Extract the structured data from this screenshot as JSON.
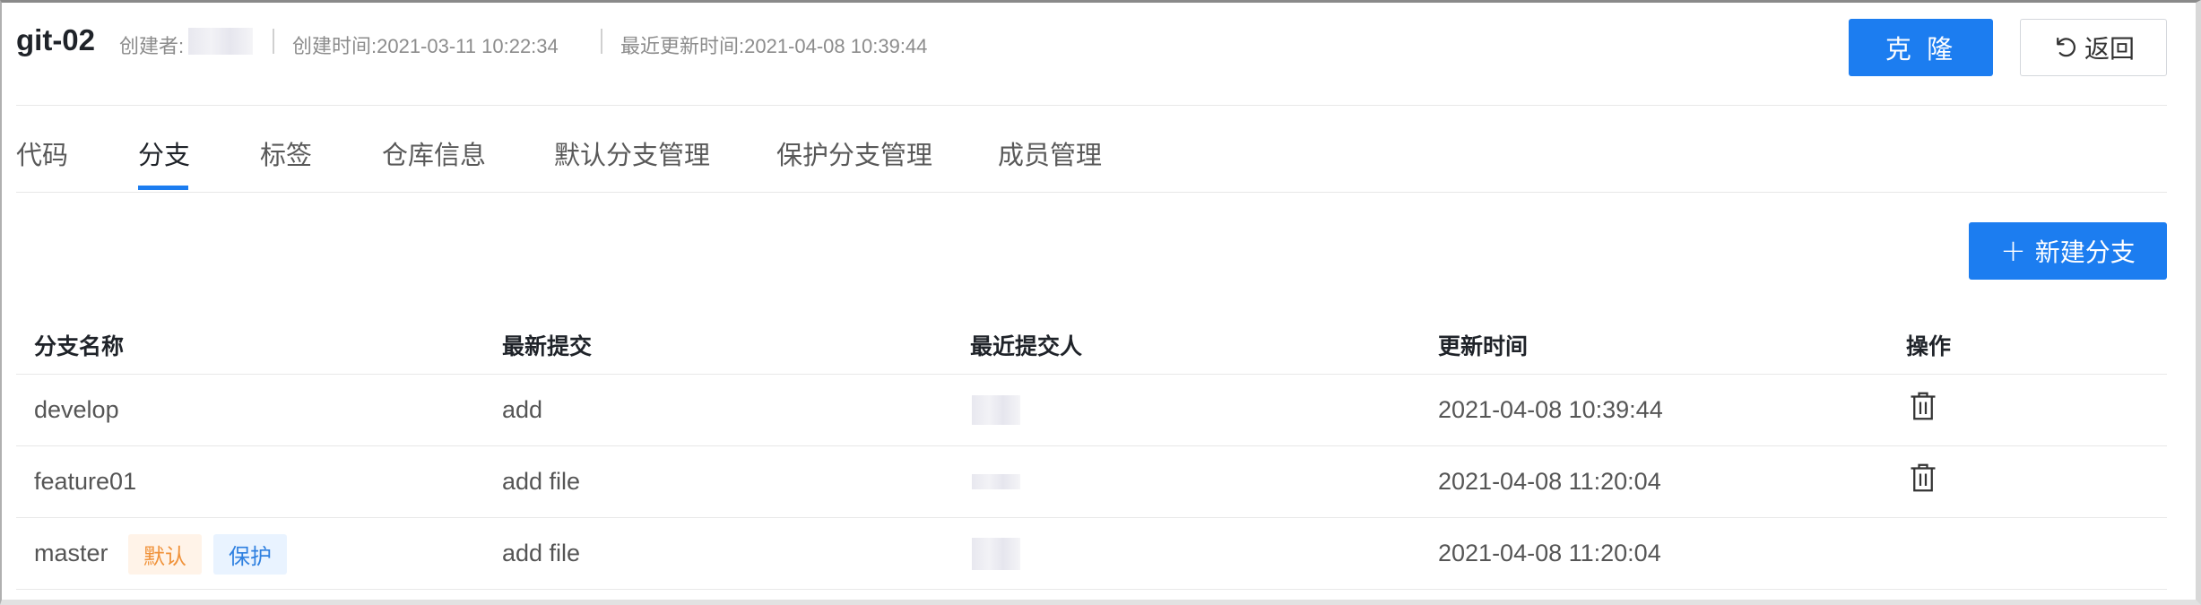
{
  "header": {
    "repo_name": "git-02",
    "creator_label": "创建者:",
    "created_time": "创建时间:2021-03-11 10:22:34",
    "updated_time": "最近更新时间:2021-04-08 10:39:44",
    "clone_button": "克 隆",
    "back_button": "返回"
  },
  "tabs": [
    {
      "label": "代码",
      "active": false
    },
    {
      "label": "分支",
      "active": true
    },
    {
      "label": "标签",
      "active": false
    },
    {
      "label": "仓库信息",
      "active": false
    },
    {
      "label": "默认分支管理",
      "active": false
    },
    {
      "label": "保护分支管理",
      "active": false
    },
    {
      "label": "成员管理",
      "active": false
    }
  ],
  "toolbar": {
    "new_branch_icon": "+",
    "new_branch_label": "新建分支"
  },
  "table": {
    "columns": [
      "分支名称",
      "最新提交",
      "最近提交人",
      "更新时间",
      "操作"
    ],
    "rows": [
      {
        "name": "develop",
        "commit": "add",
        "updated": "2021-04-08 10:39:44",
        "tags": [],
        "deletable": true
      },
      {
        "name": "feature01",
        "commit": "add file",
        "updated": "2021-04-08 11:20:04",
        "tags": [],
        "deletable": true
      },
      {
        "name": "master",
        "commit": "add file",
        "updated": "2021-04-08 11:20:04",
        "tags": [
          "默认",
          "保护"
        ],
        "deletable": false
      }
    ]
  },
  "colors": {
    "primary": "#1c7df0",
    "default_tag_bg": "#fff3e8",
    "default_tag_text": "#f0923a",
    "protect_tag_bg": "#e9f3ff",
    "protect_tag_text": "#2f80e0"
  },
  "icons": {
    "back": "undo-arrow-icon",
    "new_branch": "plus-icon",
    "delete": "trash-icon"
  }
}
